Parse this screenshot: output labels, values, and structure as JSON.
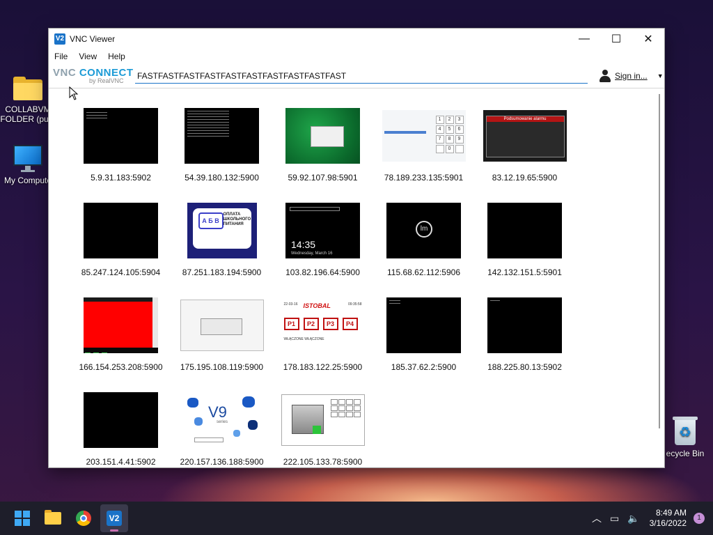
{
  "desktop": {
    "icons": [
      {
        "label": "COLLABVM FOLDER (pu..."
      },
      {
        "label": "My Compute"
      },
      {
        "label": "ecycle Bin"
      }
    ]
  },
  "window": {
    "title": "VNC Viewer",
    "controls": {
      "minimize": "—",
      "maximize": "☐",
      "close": "✕"
    }
  },
  "menu": [
    "File",
    "View",
    "Help"
  ],
  "toolbar": {
    "brand_left": "VNC",
    "brand_right": " CONNECT",
    "brand_sub": "by RealVNC",
    "search_value": "FASTFASTFASTFASTFASTFASTFASTFASTFASTFAST",
    "signin_label": "Sign in...",
    "caret": "▼"
  },
  "connections": [
    {
      "label": "5.9.31.183:5902"
    },
    {
      "label": "54.39.180.132:5900"
    },
    {
      "label": "59.92.107.98:5901"
    },
    {
      "label": "78.189.233.135:5901"
    },
    {
      "label": "83.12.19.65:5900"
    },
    {
      "label": "85.247.124.105:5904"
    },
    {
      "label": "87.251.183.194:5900"
    },
    {
      "label": "103.82.196.64:5900"
    },
    {
      "label": "115.68.62.112:5906"
    },
    {
      "label": "142.132.151.5:5901"
    },
    {
      "label": "166.154.253.208:5900"
    },
    {
      "label": "175.195.108.119:5900"
    },
    {
      "label": "178.183.122.25:5900"
    },
    {
      "label": "185.37.62.2:5900"
    },
    {
      "label": "188.225.80.13:5902"
    },
    {
      "label": "203.151.4.41:5902"
    },
    {
      "label": "220.157.136.188:5900"
    },
    {
      "label": "222.105.133.78:5900"
    }
  ],
  "thumbs": {
    "kiosk_keys": [
      "1",
      "2",
      "3",
      "4",
      "5",
      "6",
      "7",
      "8",
      "9",
      "",
      "0",
      ""
    ],
    "dark_dialog_title": "Podsumowanie alarmu",
    "card_letters": "А Б В",
    "card_text": "ОПЛАТА ШКОЛЬНОГО ПИТАНИЯ",
    "lock_time": "14:35",
    "lock_date": "Wednesday, March 16",
    "istobal_logo": "ISTOBAL",
    "istobal_date": "22-03-16",
    "istobal_time": "09:35:58",
    "istobal_p": [
      "P1",
      "P2",
      "P3",
      "P4"
    ],
    "istobal_status": "WŁĄCZONE  WŁĄCZONE",
    "v9_text": "V9",
    "v9_sub": "series"
  },
  "taskbar": {
    "clock_time": "8:49 AM",
    "clock_date": "3/16/2022",
    "notification_count": "1",
    "tray_chevron": "︿",
    "tray_network": "▭",
    "tray_volume": "🔈"
  }
}
